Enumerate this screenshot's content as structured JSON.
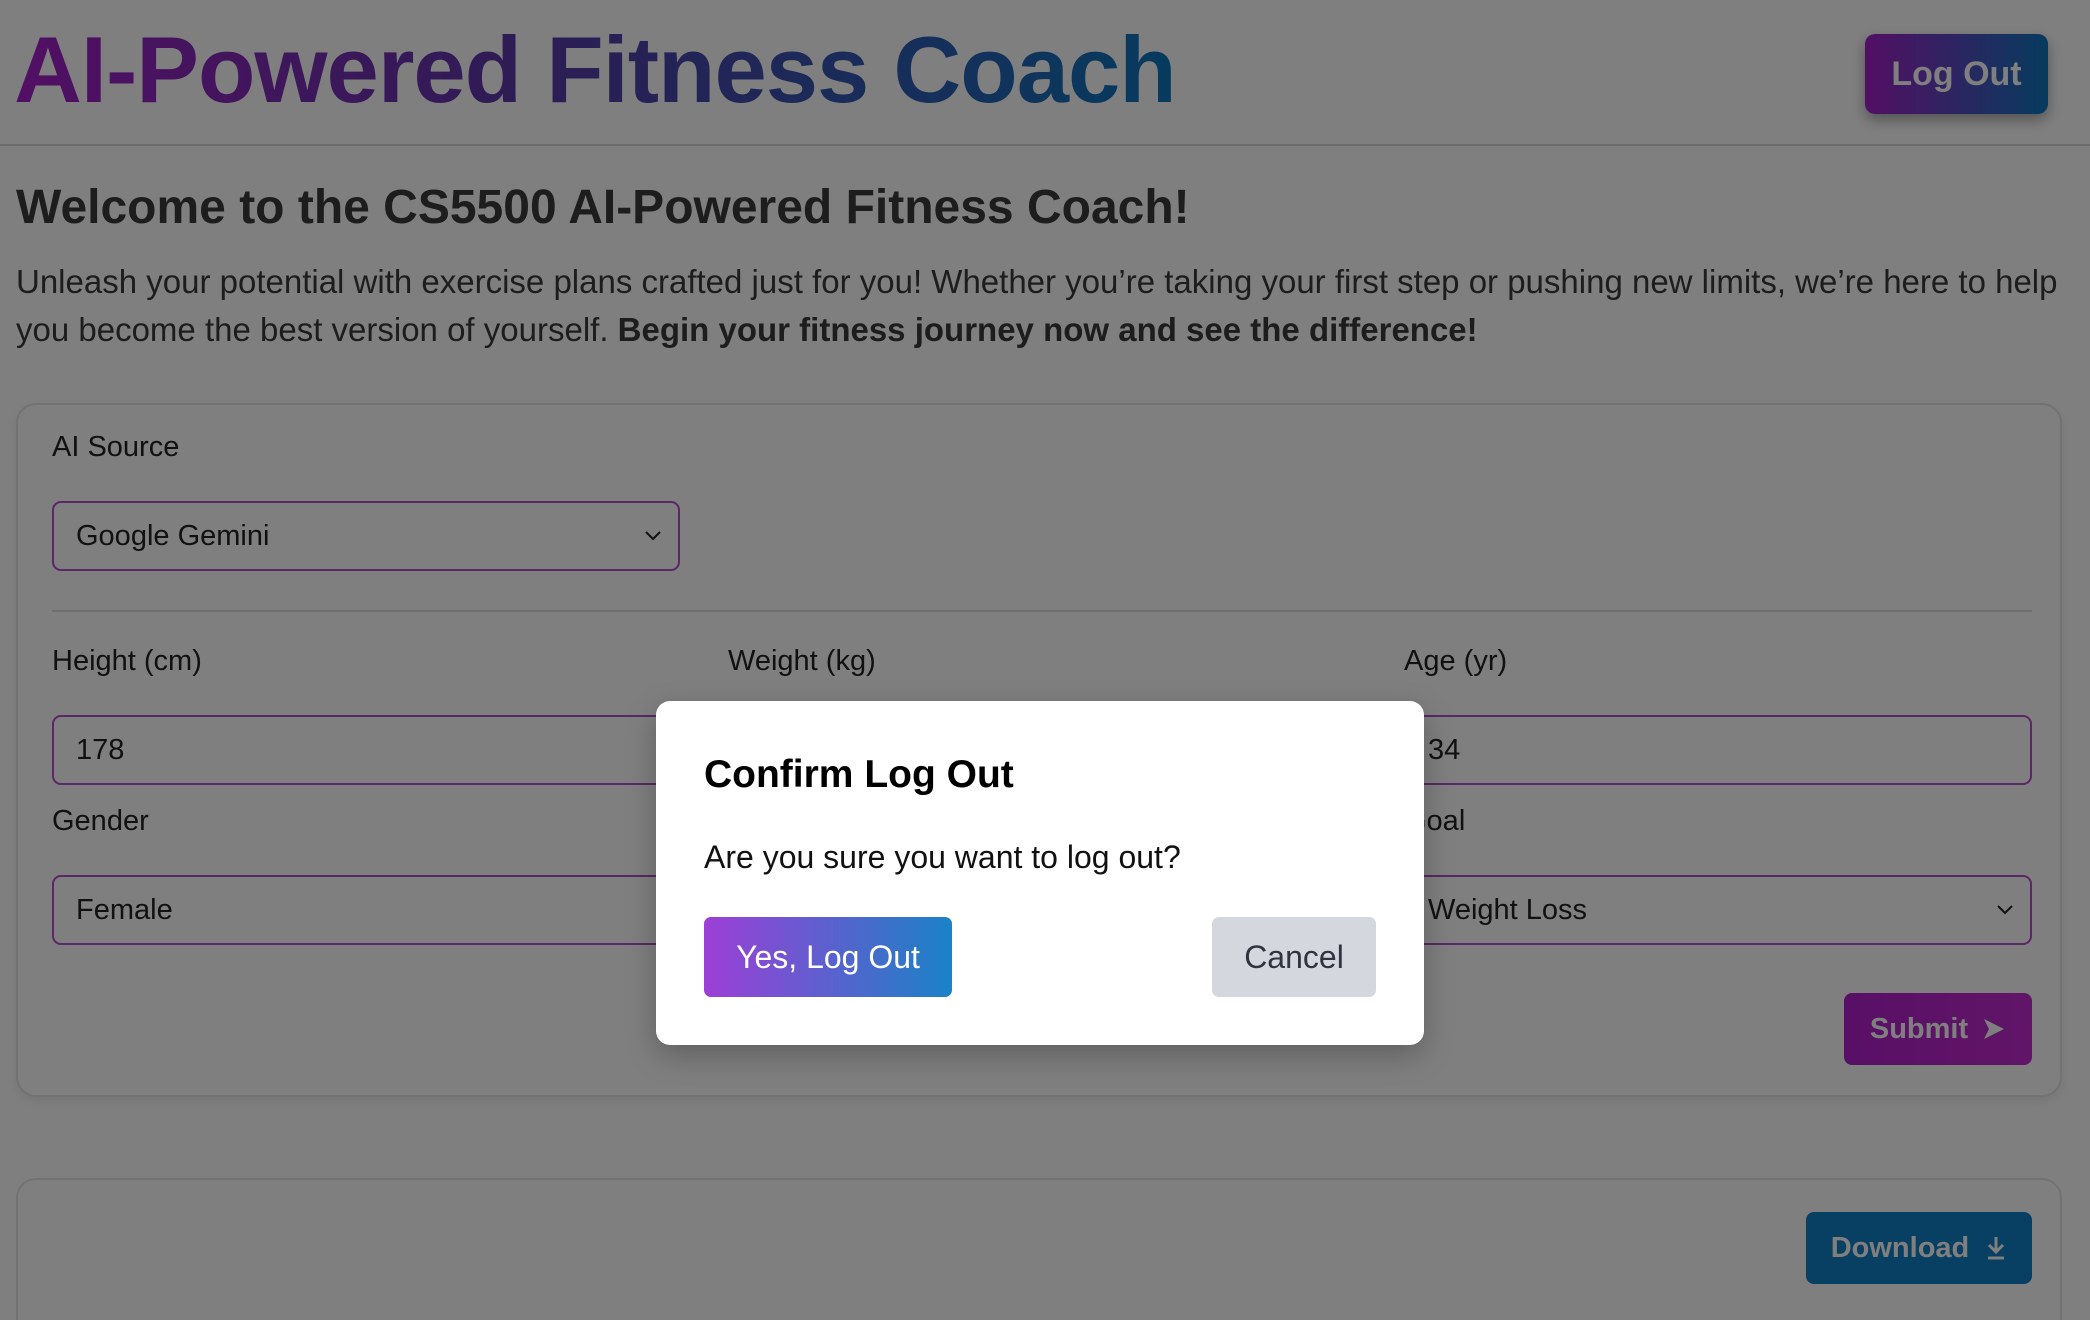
{
  "header": {
    "title": "AI-Powered Fitness Coach",
    "logout_label": "Log Out"
  },
  "welcome": {
    "heading": "Welcome to the CS5500 AI-Powered Fitness Coach!",
    "text": "Unleash your potential with exercise plans crafted just for you! Whether you’re taking your first step or pushing new limits, we’re here to help you become the best version of yourself. ",
    "text_bold": "Begin your fitness journey now and see the difference!"
  },
  "form": {
    "ai_source": {
      "label": "AI Source",
      "selected": "Google Gemini"
    },
    "height": {
      "label": "Height (cm)",
      "value": "178"
    },
    "weight": {
      "label": "Weight (kg)",
      "value": ""
    },
    "age": {
      "label": "Age (yr)",
      "value": "34"
    },
    "gender": {
      "label": "Gender",
      "selected": "Female"
    },
    "goal": {
      "label": "Goal",
      "selected": "Weight Loss"
    },
    "submit_label": "Submit"
  },
  "results": {
    "download_label": "Download"
  },
  "modal": {
    "title": "Confirm Log Out",
    "message": "Are you sure you want to log out?",
    "confirm_label": "Yes, Log Out",
    "cancel_label": "Cancel"
  },
  "colors": {
    "brand_gradient_start": "#a41fc8",
    "brand_gradient_end": "#0d77bd",
    "field_border": "#b84ed0",
    "cancel_bg": "#d4d7de",
    "overlay": "rgba(0,0,0,0.5)"
  }
}
